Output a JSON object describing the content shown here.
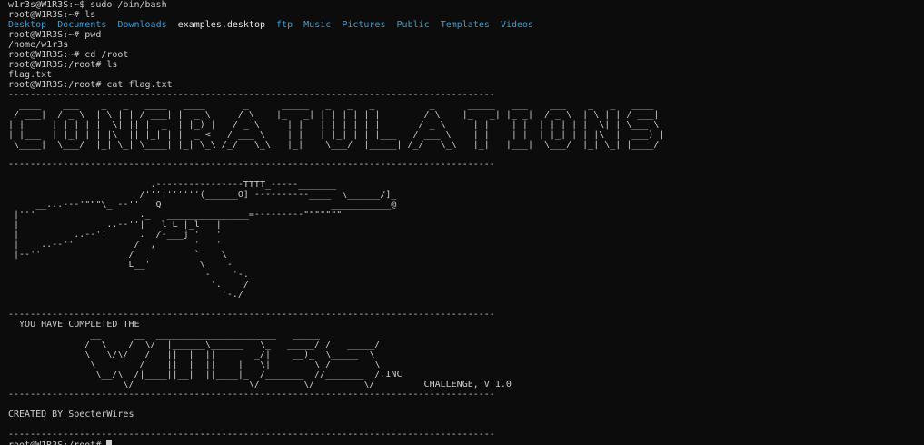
{
  "theme": {
    "background": "#0c0c0c",
    "foreground": "#cccccc",
    "directory_color": "#3b9fd8",
    "file_color": "#e8e8e8"
  },
  "terminal": {
    "lines": [
      "w1r3s@W1R3S:~$ sudo /bin/bash",
      "root@W1R3S:~# ls",
      "",
      "root@W1R3S:~# pwd",
      "/home/w1r3s",
      "root@W1R3S:~# cd /root",
      "root@W1R3S:/root# ls",
      "flag.txt",
      "root@W1R3S:/root# cat flag.txt"
    ],
    "ls_output": [
      {
        "name": "Desktop",
        "kind": "dir"
      },
      {
        "name": "Documents",
        "kind": "dir"
      },
      {
        "name": "Downloads",
        "kind": "dir"
      },
      {
        "name": "examples.desktop",
        "kind": "file"
      },
      {
        "name": "ftp",
        "kind": "dir"
      },
      {
        "name": "Music",
        "kind": "dir"
      },
      {
        "name": "Pictures",
        "kind": "dir"
      },
      {
        "name": "Public",
        "kind": "dir"
      },
      {
        "name": "Templates",
        "kind": "dir"
      },
      {
        "name": "Videos",
        "kind": "dir"
      }
    ],
    "flag_lines": [
      "-----------------------------------------------------------------------------------------",
      "  ____    ___    _   _   ____   ____       _      _____   _   _   _          _      _____   ___    ___    _   _   ____  ",
      " / ___|  / _ \\  | \\ | | / ___| |  _ \\     / \\    |_   _| | | | | | |        / \\    |_   _| |_ _|  / _ \\  | \\ | | / ___| ",
      "| |     | | | | |  \\| || |  _  | |_) |   / _ \\     | |   | | | | | |       / _ \\     | |    | |  | | | | |  \\| | \\___ \\ ",
      "| |___  | |_| | | |\\  || |_| | |  _ <   / ___ \\    | |   | |_| | | |___   / ___ \\    | |    | |  | |_| | | |\\  |  ___) |",
      " \\____|  \\___/  |_| \\_| \\____| |_| \\_\\ /_/   \\_\\   |_|    \\___/  |_____| /_/   \\_\\   |_|   |___|  \\___/  |_| \\_| |____/ ",
      "",
      "-----------------------------------------------------------------------------------------",
      "",
      "                          .----------------TTTT_-----_______",
      "                        /''''''''''(______O] ----------____  \\______/]_",
      "     __...---'\"\"\"\\_ --''   Q                               ___________@",
      " |'''                   ._   _______________=---------\"\"\"\"\"\"\"",
      " |                ..--''|   l L |_l   |",
      " |          ..--''      .  /-___j '   '",
      " |    ..--''           /  ,       '   '",
      " |--''                /           `    \\",
      "                      L__'         \\    -",
      "                                    -    '-.",
      "                                     '.    /",
      "                                       '-./",
      "",
      "-----------------------------------------------------------------------------------------",
      "  YOU HAVE COMPLETED THE",
      "               __      __  ______________________   _____",
      "              /  \\    /  \\/  |______\\______   \\_   _____/ /   _____/",
      "              \\   \\/\\/   /   ||  |  ||       _/|    __)_  \\_____  \\",
      "               \\        /    ||  |  ||    |   \\|        \\ /        \\",
      "                \\__/\\  /|____||__|  ||____|_  /_______  //_______  /.INC",
      "                     \\/                     \\/        \\/         \\/         CHALLENGE, V 1.0",
      "-----------------------------------------------------------------------------------------",
      "",
      "CREATED BY SpecterWires",
      "",
      "-----------------------------------------------------------------------------------------",
      "root@W1R3S:/root# "
    ]
  }
}
